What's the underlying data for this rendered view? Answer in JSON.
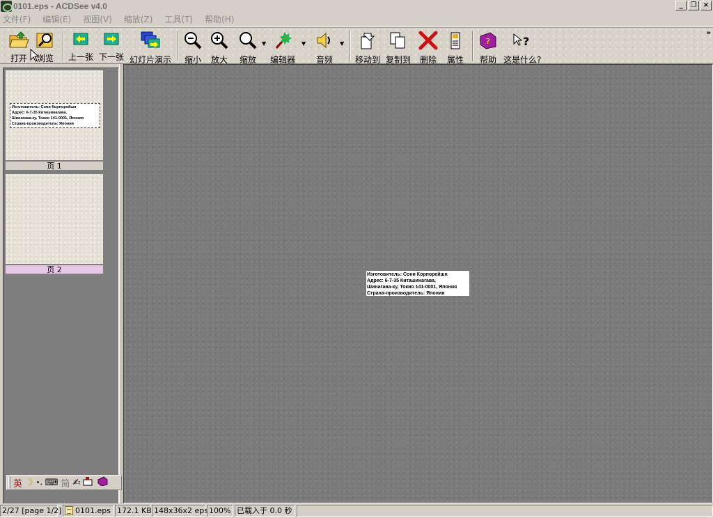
{
  "window": {
    "title": "0101.eps - ACDSee v4.0",
    "controls": {
      "minimize": "_",
      "restore": "❐",
      "close": "×"
    }
  },
  "menu": [
    "文件(F)",
    "编辑(E)",
    "视图(V)",
    "缩放(Z)",
    "工具(T)",
    "帮助(H)"
  ],
  "toolbar": {
    "open": "打开",
    "browse": "浏览",
    "previous": "上一张",
    "next": "下一张",
    "slideshow": "幻灯片演示",
    "zoom_out": "缩小",
    "zoom_in": "放大",
    "zoom": "缩放",
    "editor": "编辑器",
    "audio": "音频",
    "move_to": "移动到",
    "copy_to": "复制到",
    "delete": "删除",
    "properties": "属性",
    "help": "帮助",
    "whats_this": "这是什么?",
    "more": "»"
  },
  "pages": [
    {
      "label": "页 1",
      "selected": false,
      "preview_lines": [
        "Изготовитель: Сони Корпорейшн",
        "Адрес: 6-7-35 Киташинагава,",
        "  Шинагава-ку, Токио 141-0001, Япония",
        "Страна-производитель: Япония"
      ]
    },
    {
      "label": "页 2",
      "selected": true,
      "preview_lines": []
    }
  ],
  "document": {
    "lines": [
      "Изготовитель: Сони Корпорейшн",
      "Адрес: 6-7-35 Киташинагава,",
      "  Шинагава-ку, Токио 141-0001, Япония",
      "Страна-производитель: Япония"
    ]
  },
  "ime": {
    "mode": "英",
    "moon": "☽",
    "punct": "•,",
    "keyboard": "⌨",
    "simplified": "简",
    "pen": "✍"
  },
  "status": {
    "position": "2/27 [page 1/2]",
    "filename": "0101.eps",
    "size": "172.1 KB",
    "dimensions": "148x36x2 eps",
    "zoom": "100%",
    "load_time": "已载入于 0.0 秒"
  },
  "colors": {
    "viewer_bg": "#7b7b7b",
    "selected_page": "#e6c8e6",
    "page_label_bg": "#d4d0c8"
  }
}
